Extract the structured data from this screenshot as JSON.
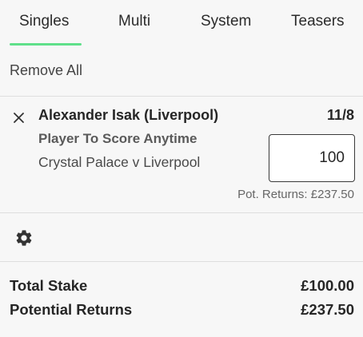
{
  "tabs": [
    {
      "label": "Singles",
      "active": true
    },
    {
      "label": "Multi",
      "active": false
    },
    {
      "label": "System",
      "active": false
    },
    {
      "label": "Teasers",
      "active": false
    }
  ],
  "accent_color": "#5fe08a",
  "remove_all_label": "Remove All",
  "bet": {
    "close_icon": "close-icon",
    "selection": "Alexander Isak (Liverpool)",
    "odds": "11/8",
    "market": "Player To Score Anytime",
    "event": "Crystal Palace v Liverpool",
    "stake": "100",
    "potential_returns": "Pot. Returns: £237.50"
  },
  "settings_icon": "gear-icon",
  "summary": {
    "total_stake_label": "Total Stake",
    "total_stake_value": "£100.00",
    "potential_returns_label": "Potential Returns",
    "potential_returns_value": "£237.50"
  }
}
